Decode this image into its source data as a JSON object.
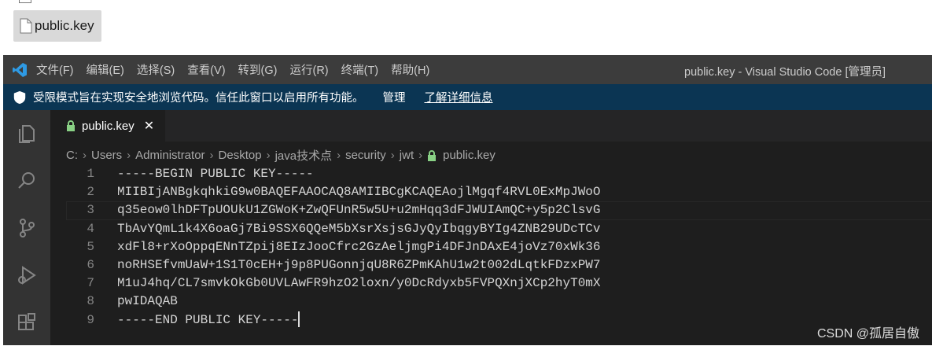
{
  "explorer": {
    "file": "public.key"
  },
  "titlebar": {
    "menu": [
      "文件(F)",
      "编辑(E)",
      "选择(S)",
      "查看(V)",
      "转到(G)",
      "运行(R)",
      "终端(T)",
      "帮助(H)"
    ],
    "title": "public.key - Visual Studio Code [管理员]"
  },
  "banner": {
    "text": "受限模式旨在实现安全地浏览代码。信任此窗口以启用所有功能。",
    "manage": "管理",
    "learn": "了解详细信息"
  },
  "tab": {
    "label": "public.key"
  },
  "breadcrumb": [
    "C:",
    "Users",
    "Administrator",
    "Desktop",
    "java技术点",
    "security",
    "jwt",
    "public.key"
  ],
  "lines": [
    "-----BEGIN PUBLIC KEY-----",
    "MIIBIjANBgkqhkiG9w0BAQEFAAOCAQ8AMIIBCgKCAQEAojlMgqf4RVL0ExMpJWoO",
    "q35eow0lhDFTpUOUkU1ZGWoK+ZwQFUnR5w5U+u2mHqq3dFJWUIAmQC+y5p2ClsvG",
    "TbAvYQmL1k4X6oaGj7Bi9SSX6QQeM5bXsrXsjsGJyQyIbqgyBYIg4ZNB29UDcTCv",
    "xdFl8+rXoOppqENnTZpij8EIzJooCfrc2GzAeljmgPi4DFJnDAxE4joVz70xWk36",
    "noRHSEfvmUaW+1S1T0cEH+j9p8PUGonnjqU8R6ZPmKAhU1w2t002dLqtkFDzxPW7",
    "M1uJ4hq/CL7smvkOkGb0UVLAwFR9hzO2loxn/y0DcRdyxb5FVPQXnjXCp2hyT0mX",
    "pwIDAQAB",
    "-----END PUBLIC KEY-----"
  ],
  "line_numbers": [
    "1",
    "2",
    "3",
    "4",
    "5",
    "6",
    "7",
    "8",
    "9"
  ],
  "watermark": "CSDN @孤居自傲"
}
